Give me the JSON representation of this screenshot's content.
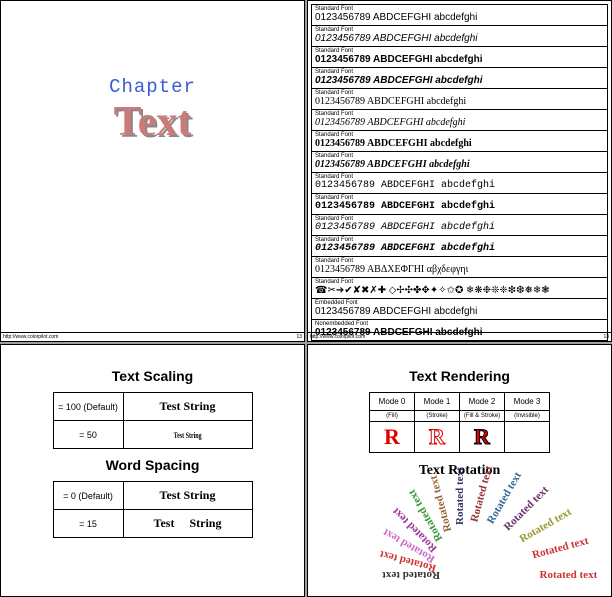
{
  "footer": {
    "url": "http://www.colorpilot.com",
    "pnum": "13"
  },
  "page1": {
    "chapter": "Chapter",
    "title": "Text"
  },
  "fontList": {
    "label": "Standard Font",
    "labelEmb": "Embedded Font",
    "labelNon": "Nonembedded Font",
    "sample": "0123456789 ABDCEFGHI abcdefghi",
    "greek": "0123456789 ΑΒΔΧΕΦΓΗΙ αβχδεφγηι",
    "dingbats": "☎✂➔✔✘✖✗✚ ◇✢✣✤✥✦✧✩✪ ❄❋❉❊❈❇❆❅❄❃"
  },
  "scaling": {
    "title": "Text Scaling",
    "r1label": "= 100 (Default)",
    "r1value": "Test String",
    "r2label": "= 50",
    "r2value": "Test String"
  },
  "wordspacing": {
    "title": "Word Spacing",
    "r1label": "= 0 (Default)",
    "r1value": "Test String",
    "r2label": "= 15",
    "r2value": "Test   String"
  },
  "rendering": {
    "title": "Text Rendering",
    "modes": [
      "Mode 0",
      "Mode 1",
      "Mode 2",
      "Mode 3"
    ],
    "subs": [
      "(Fill)",
      "(Stroke)",
      "(Fill & Stroke)",
      "(Invisible)"
    ],
    "letter": "R"
  },
  "rotation": {
    "title": "Text Rotation",
    "label": "Rotated text",
    "items": [
      {
        "deg": 180,
        "r": 20,
        "c": "#333"
      },
      {
        "deg": 165,
        "r": 25,
        "c": "#c33"
      },
      {
        "deg": 150,
        "r": 30,
        "c": "#c6c"
      },
      {
        "deg": 135,
        "r": 35,
        "c": "#939"
      },
      {
        "deg": 120,
        "r": 40,
        "c": "#393"
      },
      {
        "deg": 105,
        "r": 45,
        "c": "#963"
      },
      {
        "deg": 90,
        "r": 50,
        "c": "#336"
      },
      {
        "deg": 75,
        "r": 55,
        "c": "#933"
      },
      {
        "deg": 60,
        "r": 60,
        "c": "#369"
      },
      {
        "deg": 45,
        "r": 65,
        "c": "#636"
      },
      {
        "deg": 30,
        "r": 70,
        "c": "#993"
      },
      {
        "deg": 15,
        "r": 75,
        "c": "#c33"
      },
      {
        "deg": 0,
        "r": 80,
        "c": "#c33"
      }
    ]
  }
}
